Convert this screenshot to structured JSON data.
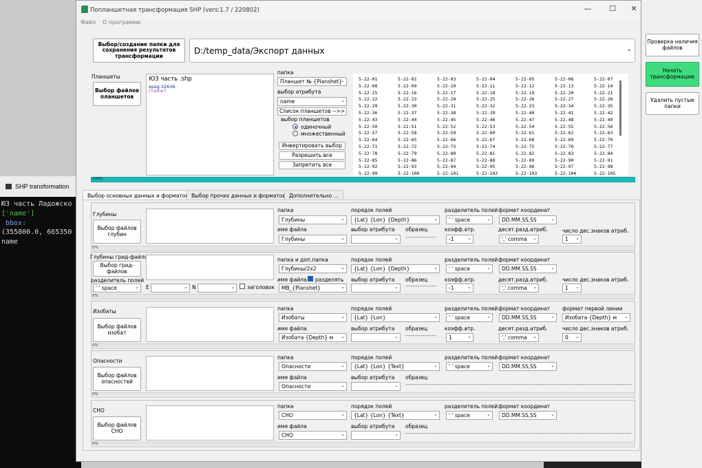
{
  "console": {
    "tab_title": "SHP transformation",
    "lines": [
      "ЮЗ часть Ладожско",
      "['name']",
      " bbox:",
      "(355800.0, 665350",
      "name"
    ]
  },
  "window": {
    "title": "Попланшетная трансформация SHP (vers:1.7 / 220802)",
    "controls": {
      "minimize": "—",
      "maximize": "☐",
      "close": "✕"
    }
  },
  "menu": [
    "Файл",
    "О программе"
  ],
  "top": {
    "select_folder_button": "Выбор/создание папки для сохранения результатов трансформации",
    "output_path": "D:/temp_data/Экспорт данных"
  },
  "sheets": {
    "group_label": "Планшеты",
    "select_button": "Выбор файлов планшетов",
    "file_info": {
      "name": "ЮЗ часть .shp",
      "epsg": "epsg:32636",
      "attr": "['name']"
    },
    "folder_label": "папка",
    "folder_value": "Планшет № {Planshet}",
    "attr_label": "выбор атрибута",
    "attr_value": "name",
    "list_button": "Список планшетов -->>",
    "choice_label": "выбор планшетов",
    "radio_single": "одиночный",
    "radio_multiple": "множественный",
    "invert_button": "Инвертировать выбор",
    "allow_all_button": "Разрешить все",
    "deny_all_button": "Запретить все",
    "progress": "100%"
  },
  "sheet_grid": {
    "columns": [
      [
        "5-22-01",
        "5-22-08",
        "5-22-15",
        "5-22-22",
        "5-22-29",
        "5-22-36",
        "5-22-43",
        "5-22-50",
        "5-22-57",
        "5-22-64",
        "5-22-71",
        "5-22-78",
        "5-22-85",
        "5-22-92",
        "5-22-99"
      ],
      [
        "5-22-02",
        "5-22-09",
        "5-22-16",
        "5-22-23",
        "5-22-30",
        "5-22-37",
        "5-22-44",
        "5-22-51",
        "5-22-58",
        "5-22-65",
        "5-22-72",
        "5-22-79",
        "5-22-86",
        "5-22-93",
        "5-22-100"
      ],
      [
        "5-22-03",
        "5-22-10",
        "5-22-17",
        "5-22-24",
        "5-22-31",
        "5-22-38",
        "5-22-45",
        "5-22-52",
        "5-22-59",
        "5-22-66",
        "5-22-73",
        "5-22-80",
        "5-22-87",
        "5-22-94",
        "5-22-101"
      ],
      [
        "5-22-04",
        "5-22-11",
        "5-22-18",
        "5-22-25",
        "5-22-32",
        "5-22-39",
        "5-22-46",
        "5-22-53",
        "5-22-60",
        "5-22-67",
        "5-22-74",
        "5-22-81",
        "5-22-88",
        "5-22-95",
        "5-22-102"
      ],
      [
        "5-22-05",
        "5-22-12",
        "5-22-19",
        "5-22-26",
        "5-22-33",
        "5-22-40",
        "5-22-47",
        "5-22-54",
        "5-22-61",
        "5-22-68",
        "5-22-75",
        "5-22-82",
        "5-22-89",
        "5-22-96",
        "5-22-103"
      ],
      [
        "5-22-06",
        "5-22-13",
        "5-22-20",
        "5-22-27",
        "5-22-34",
        "5-22-41",
        "5-22-48",
        "5-22-55",
        "5-22-62",
        "5-22-69",
        "5-22-76",
        "5-22-83",
        "5-22-90",
        "5-22-97",
        "5-22-104"
      ],
      [
        "5-22-07",
        "5-22-14",
        "5-22-21",
        "5-22-28",
        "5-22-35",
        "5-22-42",
        "5-22-49",
        "5-22-56",
        "5-22-63",
        "5-22-70",
        "5-22-77",
        "5-22-84",
        "5-22-91",
        "5-22-98",
        "5-22-105"
      ]
    ]
  },
  "tabs": [
    "Выбор основных данных и форматов",
    "Выбор прочих данных и форматов",
    "Дополнительно ..."
  ],
  "labels": {
    "folder": "папка",
    "folder_ext": "папка и доп.папка",
    "file_name": "имя файла",
    "field_order": "порядок полей",
    "attr_choice": "выбор атрибута",
    "sample": "образец",
    "field_sep": "разделитель полей",
    "coord_format": "формат координат",
    "attr_coef": "коэфф.атр.",
    "decimal_sep": "десят.разд.атриб.",
    "decimals": "число дес.знаков атриб.",
    "first_line_format": "формат первой линии",
    "split": "разделять",
    "header": "заголовок",
    "e": "E",
    "n": "N",
    "sample_dashes": "------------------",
    "long_dashes": "--------------------------------------------------------------------------------------------------------------------------------------------------",
    "progress": "0%"
  },
  "depths": {
    "title": "Глубины",
    "button": "Выбор файлов глубин",
    "folder": "Глубины",
    "file": "Глубины",
    "order": "{Lat} {Lon} {Depth}",
    "sep": "' ' space",
    "coord": "DD.MM.SS,SS",
    "coef": "-1",
    "dec": "',' comma",
    "digits": "1"
  },
  "grid_depths": {
    "title": "Глубины грид-файлов",
    "button": "Выбор грид-файлов",
    "sep_label": "разделитель полей",
    "sep_value": "' ' space",
    "folder": "Глубины/2х2",
    "file": "MB_{Planshet}",
    "order": "{Lat} {Lon} {Depth}",
    "sep": "' ' space",
    "coord": "DD.MM.SS,SS",
    "coef": "-1",
    "dec": "',' comma",
    "digits": "1"
  },
  "isobaths": {
    "title": "Изобаты",
    "button": "Выбор файлов изобат",
    "folder": "Изобаты",
    "file": "Изобата {Depth} м",
    "order": "{Lat} {Lon}",
    "sep": "' ' space",
    "coord": "DD.MM.SS,SS",
    "first_line": "Изобата {Depth} м",
    "coef": "1",
    "dec": "',' comma",
    "digits": "0"
  },
  "hazards": {
    "title": "Опасности",
    "button": "Выбор файлов опасностей",
    "folder": "Опасности",
    "file": "Опасности",
    "order": "{Lat} {Lon} {Text}",
    "sep": "' ' space",
    "coord": "DD.MM.SS,SS"
  },
  "sno": {
    "title": "СНО",
    "button": "Выбор файлов СНО",
    "folder": "СНО",
    "file": "СНО",
    "order": "{Lat} {Lon} {Text}",
    "sep": "' ' space",
    "coord": "DD.MM.SS,SS"
  },
  "side": {
    "check_button": "Проверка наличия файлов",
    "start_button": "Начать трансформацию",
    "delete_button": "Удалить пустые папки",
    "start_color": "#3fdc7e"
  },
  "colors": {
    "progress_fill": "#1fb8b8",
    "checkbox_accent": "#1a5fb4"
  }
}
